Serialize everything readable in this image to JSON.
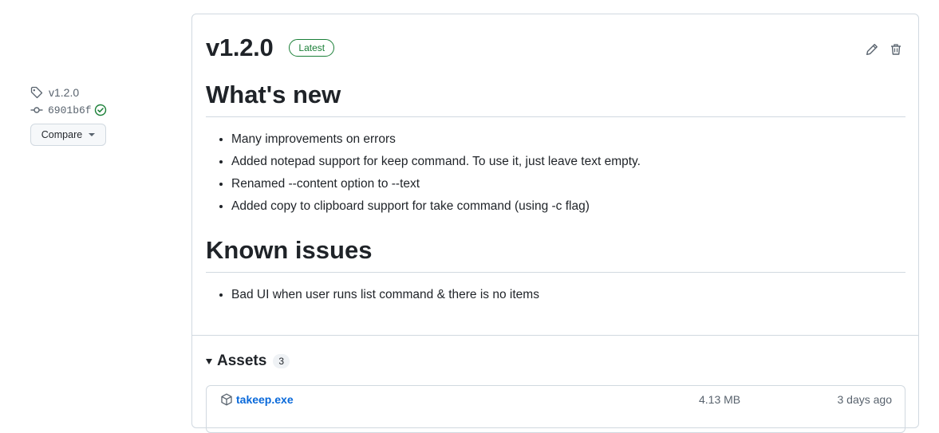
{
  "sidebar": {
    "tag": "v1.2.0",
    "commit": "6901b6f",
    "compare_label": "Compare"
  },
  "release": {
    "title": "v1.2.0",
    "badge": "Latest",
    "sections": [
      {
        "heading": "What's new",
        "items": [
          "Many improvements on errors",
          "Added notepad support for keep command. To use it, just leave text empty.",
          "Renamed --content option to --text",
          "Added copy to clipboard support for take command (using -c flag)"
        ]
      },
      {
        "heading": "Known issues",
        "items": [
          "Bad UI when user runs list command & there is no items"
        ]
      }
    ]
  },
  "assets": {
    "label": "Assets",
    "count": "3",
    "files": [
      {
        "name": "takeep.exe",
        "size": "4.13 MB",
        "date": "3 days ago"
      }
    ]
  },
  "colors": {
    "accent_link": "#0969da",
    "latest_green": "#1a7f37",
    "border": "#d1d9e0"
  }
}
